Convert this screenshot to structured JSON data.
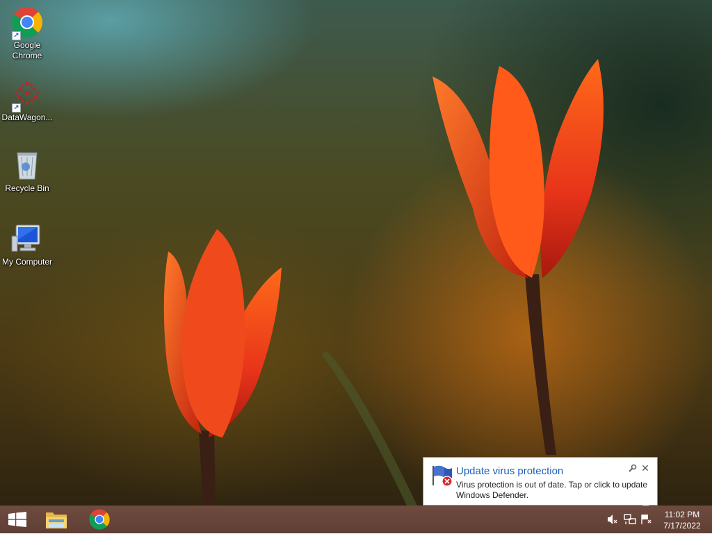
{
  "desktop": {
    "icons": [
      {
        "label": "Google Chrome",
        "icon": "chrome-icon"
      },
      {
        "label": "DataWagon...",
        "icon": "datawagon-icon"
      },
      {
        "label": "Recycle Bin",
        "icon": "recycle-bin-icon"
      },
      {
        "label": "My Computer",
        "icon": "my-computer-icon"
      }
    ]
  },
  "notification": {
    "title": "Update virus protection",
    "message": "Virus protection is out of date. Tap or click to update Windows Defender.",
    "icon": "defender-flag-error-icon",
    "close_glyph": "✕"
  },
  "taskbar": {
    "start_icon": "windows-logo-icon",
    "pinned": [
      {
        "name": "file-explorer",
        "icon": "folder-icon"
      },
      {
        "name": "google-chrome",
        "icon": "chrome-icon"
      }
    ],
    "tray": [
      {
        "name": "volume-muted",
        "icon": "speaker-muted-icon"
      },
      {
        "name": "network",
        "icon": "network-icon"
      },
      {
        "name": "action-center",
        "icon": "flag-error-icon"
      }
    ],
    "clock": {
      "time": "11:02 PM",
      "date": "7/17/2022"
    }
  },
  "colors": {
    "taskbar": "#5f3f35",
    "balloon_title": "#1d5fb8",
    "tulip": "#e8421a"
  }
}
